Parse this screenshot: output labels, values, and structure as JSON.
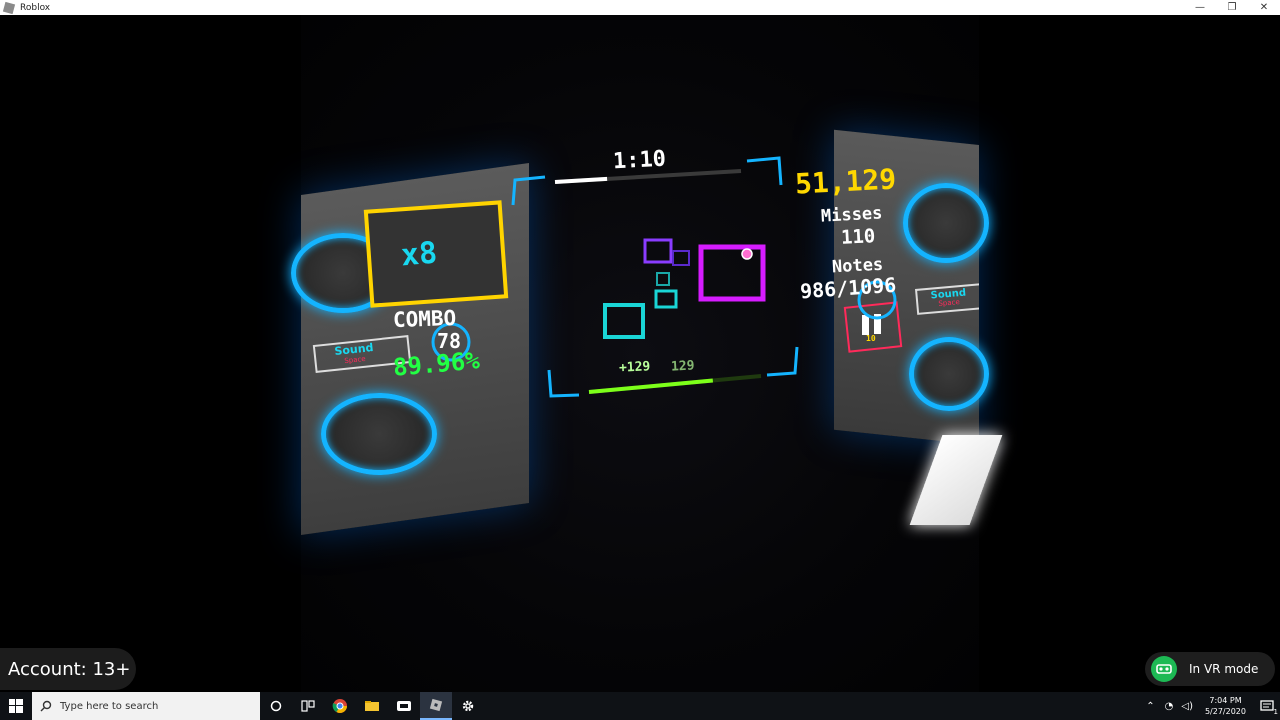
{
  "window": {
    "title": "Roblox",
    "controls": {
      "minimize": "—",
      "restore": "❐",
      "close": "✕"
    }
  },
  "hud": {
    "timer": "1:10",
    "timer_progress": 0.28,
    "score": "51,129",
    "misses_label": "Misses",
    "misses_value": "110",
    "notes_label": "Notes",
    "notes_value": "986/1096",
    "multiplier": "x8",
    "combo_label": "COMBO",
    "combo_value": "78",
    "accuracy": "89.96%",
    "score_popup": "+129",
    "score_popup_ghost": "129",
    "health_fill": 0.72,
    "pause_label": "10",
    "logo_left": {
      "line1": "Sound",
      "line2": "Space"
    },
    "logo_right": {
      "line1": "Sound",
      "line2": "Space"
    }
  },
  "colors": {
    "score": "#ffd800",
    "accuracy": "#22ff44",
    "multiplier_frame": "#ffd400",
    "multiplier_text": "#19d8f0",
    "ring": "#14b4ff",
    "note_magenta": "#d61cff",
    "note_purple": "#8a3cff",
    "note_cyan": "#1ad6d6",
    "health": "#7dff1a",
    "pause": "#ff2a5a"
  },
  "overlay": {
    "account": "Account: 13+",
    "vr_mode": "In VR mode"
  },
  "taskbar": {
    "search_placeholder": "Type here to search",
    "time": "7:04 PM",
    "date": "5/27/2020",
    "notification_count": "1",
    "apps": [
      "start-icon",
      "cortana-icon",
      "task-view-icon",
      "chrome-icon",
      "file-explorer-icon",
      "recorder-icon",
      "roblox-icon",
      "settings-icon"
    ]
  }
}
